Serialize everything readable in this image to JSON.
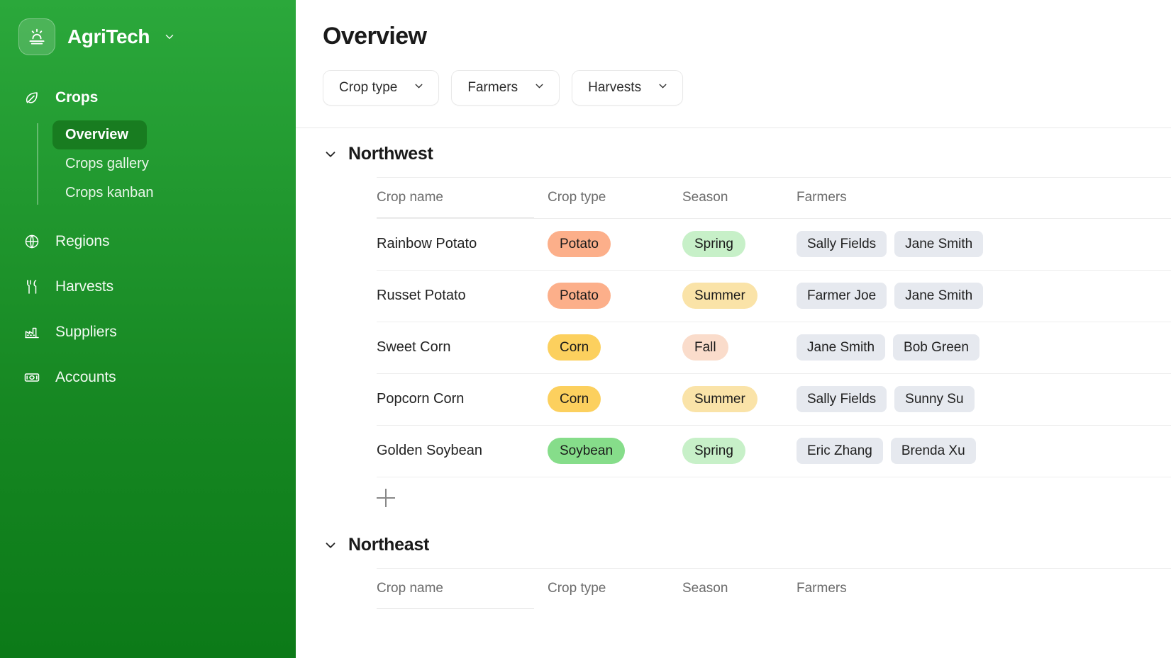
{
  "sidebar": {
    "brand": {
      "name": "AgriTech",
      "logo_icon": "sunrise-icon",
      "caret_icon": "chevron-down-icon"
    },
    "groups": [
      {
        "label": "Crops",
        "icon": "leaf-icon",
        "items": [
          {
            "label": "Overview",
            "active": true
          },
          {
            "label": "Crops gallery",
            "active": false
          },
          {
            "label": "Crops kanban",
            "active": false
          }
        ]
      }
    ],
    "items": [
      {
        "label": "Regions",
        "icon": "globe-icon"
      },
      {
        "label": "Harvests",
        "icon": "fork-knife-icon"
      },
      {
        "label": "Suppliers",
        "icon": "factory-icon"
      },
      {
        "label": "Accounts",
        "icon": "banknote-icon"
      }
    ]
  },
  "header": {
    "title": "Overview",
    "filters": [
      {
        "label": "Crop type",
        "icon": "chevron-down-icon"
      },
      {
        "label": "Farmers",
        "icon": "chevron-down-icon"
      },
      {
        "label": "Harvests",
        "icon": "chevron-down-icon"
      }
    ]
  },
  "table": {
    "columns": [
      "Crop name",
      "Crop type",
      "Season",
      "Farmers"
    ],
    "add_row_icon": "plus-icon"
  },
  "colors": {
    "potato": "#FCAF8A",
    "corn": "#FCD05E",
    "soybean": "#86DD8A",
    "spring": "#C7F0C8",
    "summer": "#FAE3A8",
    "fall": "#FADCCB",
    "chip": "#E6E9EF",
    "brand_green": "#21982F"
  },
  "sections": [
    {
      "name": "Northwest",
      "expanded": true,
      "rows": [
        {
          "crop_name": "Rainbow Potato",
          "crop_type": "Potato",
          "type_color": "#FCAF8A",
          "season": "Spring",
          "season_color": "#C7F0C8",
          "farmers": [
            "Sally Fields",
            "Jane Smith"
          ]
        },
        {
          "crop_name": "Russet Potato",
          "crop_type": "Potato",
          "type_color": "#FCAF8A",
          "season": "Summer",
          "season_color": "#FAE3A8",
          "farmers": [
            "Farmer Joe",
            "Jane Smith"
          ]
        },
        {
          "crop_name": "Sweet Corn",
          "crop_type": "Corn",
          "type_color": "#FCD05E",
          "season": "Fall",
          "season_color": "#FADCCB",
          "farmers": [
            "Jane Smith",
            "Bob Green"
          ]
        },
        {
          "crop_name": "Popcorn Corn",
          "crop_type": "Corn",
          "type_color": "#FCD05E",
          "season": "Summer",
          "season_color": "#FAE3A8",
          "farmers": [
            "Sally Fields",
            "Sunny Su"
          ]
        },
        {
          "crop_name": "Golden Soybean",
          "crop_type": "Soybean",
          "type_color": "#86DD8A",
          "season": "Spring",
          "season_color": "#C7F0C8",
          "farmers": [
            "Eric Zhang",
            "Brenda Xu"
          ]
        }
      ]
    },
    {
      "name": "Northeast",
      "expanded": true,
      "rows": []
    }
  ]
}
